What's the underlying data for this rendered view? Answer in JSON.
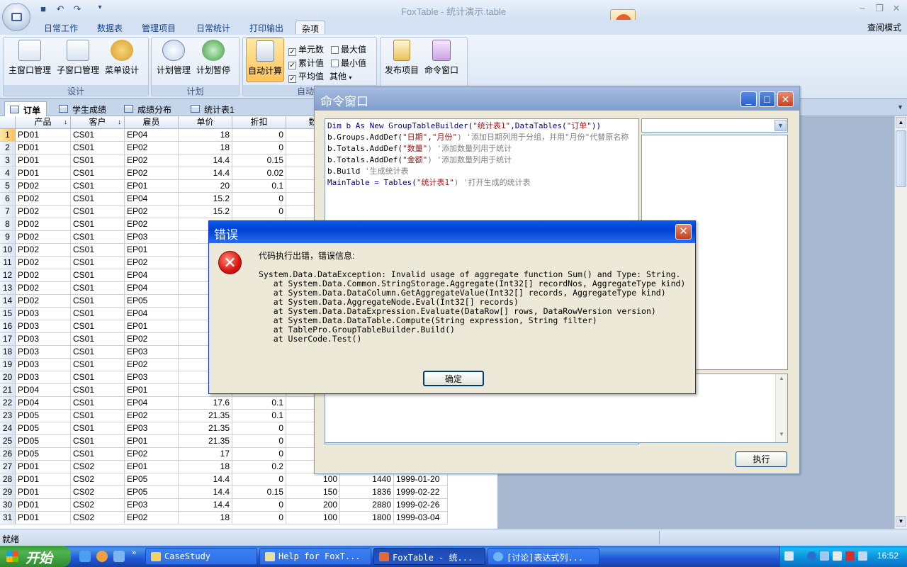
{
  "app": {
    "title": "FoxTable - 统计演示.table",
    "view_mode": "查阅模式"
  },
  "ribbon": {
    "tabs": [
      "日常工作",
      "数据表",
      "管理项目",
      "日常统计",
      "打印输出",
      "杂项"
    ],
    "groups": {
      "design": {
        "label": "设计",
        "buttons": [
          "主窗口管理",
          "子窗口管理",
          "菜单设计"
        ]
      },
      "plan": {
        "label": "计划",
        "buttons": [
          "计划管理",
          "计划暂停"
        ]
      },
      "auto": {
        "label": "自动计",
        "button": "自动计算",
        "checks": [
          {
            "label": "单元数",
            "checked": true
          },
          {
            "label": "最大值",
            "checked": false
          },
          {
            "label": "累计值",
            "checked": true
          },
          {
            "label": "最小值",
            "checked": false
          },
          {
            "label": "平均值",
            "checked": true
          }
        ],
        "other": "其他"
      },
      "publish": {
        "buttons": [
          "发布项目",
          "命令窗口"
        ]
      }
    }
  },
  "sheet_tabs": [
    "订单",
    "学生成绩",
    "成绩分布",
    "统计表1"
  ],
  "grid": {
    "columns": [
      "产品",
      "客户",
      "雇员",
      "单价",
      "折扣",
      "数"
    ],
    "rows": [
      [
        "1",
        "PD01",
        "CS01",
        "EP04",
        "18",
        "0",
        "",
        "",
        ""
      ],
      [
        "2",
        "PD01",
        "CS01",
        "EP02",
        "18",
        "0",
        "",
        "",
        ""
      ],
      [
        "3",
        "PD01",
        "CS01",
        "EP02",
        "14.4",
        "0.15",
        "",
        "",
        ""
      ],
      [
        "4",
        "PD01",
        "CS01",
        "EP02",
        "14.4",
        "0.02",
        "",
        "",
        ""
      ],
      [
        "5",
        "PD02",
        "CS01",
        "EP01",
        "20",
        "0.1",
        "",
        "",
        ""
      ],
      [
        "6",
        "PD02",
        "CS01",
        "EP04",
        "15.2",
        "0",
        "",
        "",
        ""
      ],
      [
        "7",
        "PD02",
        "CS01",
        "EP02",
        "15.2",
        "0",
        "",
        "",
        ""
      ],
      [
        "8",
        "PD02",
        "CS01",
        "EP02",
        "",
        "",
        "",
        "",
        ""
      ],
      [
        "9",
        "PD02",
        "CS01",
        "EP03",
        "",
        "",
        "",
        "",
        ""
      ],
      [
        "10",
        "PD02",
        "CS01",
        "EP01",
        "",
        "",
        "",
        "",
        ""
      ],
      [
        "11",
        "PD02",
        "CS01",
        "EP02",
        "",
        "",
        "",
        "",
        ""
      ],
      [
        "12",
        "PD02",
        "CS01",
        "EP04",
        "",
        "",
        "",
        "",
        ""
      ],
      [
        "13",
        "PD02",
        "CS01",
        "EP04",
        "",
        "",
        "",
        "",
        ""
      ],
      [
        "14",
        "PD02",
        "CS01",
        "EP05",
        "",
        "",
        "",
        "",
        ""
      ],
      [
        "15",
        "PD03",
        "CS01",
        "EP04",
        "",
        "",
        "",
        "",
        ""
      ],
      [
        "16",
        "PD03",
        "CS01",
        "EP01",
        "",
        "",
        "",
        "",
        ""
      ],
      [
        "17",
        "PD03",
        "CS01",
        "EP02",
        "",
        "",
        "",
        "",
        ""
      ],
      [
        "18",
        "PD03",
        "CS01",
        "EP03",
        "",
        "",
        "",
        "",
        ""
      ],
      [
        "19",
        "PD03",
        "CS01",
        "EP02",
        "",
        "",
        "",
        "",
        ""
      ],
      [
        "20",
        "PD03",
        "CS01",
        "EP03",
        "",
        "",
        "",
        "",
        ""
      ],
      [
        "21",
        "PD04",
        "CS01",
        "EP01",
        "",
        "",
        "",
        "",
        ""
      ],
      [
        "22",
        "PD04",
        "CS01",
        "EP04",
        "17.6",
        "0.1",
        "",
        "",
        ""
      ],
      [
        "23",
        "PD05",
        "CS01",
        "EP02",
        "21.35",
        "0.1",
        "",
        "",
        ""
      ],
      [
        "24",
        "PD05",
        "CS01",
        "EP03",
        "21.35",
        "0",
        "",
        "",
        ""
      ],
      [
        "25",
        "PD05",
        "CS01",
        "EP01",
        "21.35",
        "0",
        "",
        "",
        ""
      ],
      [
        "26",
        "PD05",
        "CS01",
        "EP02",
        "17",
        "0",
        "",
        "",
        ""
      ],
      [
        "27",
        "PD01",
        "CS02",
        "EP01",
        "18",
        "0.2",
        "",
        "",
        ""
      ],
      [
        "28",
        "PD01",
        "CS02",
        "EP05",
        "14.4",
        "0",
        "100",
        "1440",
        "1999-01-20"
      ],
      [
        "29",
        "PD01",
        "CS02",
        "EP05",
        "14.4",
        "0.15",
        "150",
        "1836",
        "1999-02-22"
      ],
      [
        "30",
        "PD01",
        "CS02",
        "EP03",
        "14.4",
        "0",
        "200",
        "2880",
        "1999-02-26"
      ],
      [
        "31",
        "PD01",
        "CS02",
        "EP02",
        "18",
        "0",
        "100",
        "1800",
        "1999-03-04"
      ]
    ]
  },
  "status": {
    "text": "就绪"
  },
  "cmd_window": {
    "title": "命令窗口",
    "code": [
      [
        {
          "t": "Dim b As New GroupTableBuilder(",
          "c": "kw"
        },
        {
          "t": "\"统计表1\"",
          "c": "str"
        },
        {
          "t": ",DataTables(",
          "c": "kw"
        },
        {
          "t": "\"订单\"",
          "c": "str"
        },
        {
          "t": "))",
          "c": "kw"
        }
      ],
      [
        {
          "t": "b.Groups.AddDef(",
          "c": ""
        },
        {
          "t": "\"日期\"",
          "c": "str"
        },
        {
          "t": ",",
          "c": ""
        },
        {
          "t": "\"月份\"",
          "c": "str"
        },
        {
          "t": ") '添加日期列用于分组，并用\"月份\"代替原名称",
          "c": "cm"
        }
      ],
      [
        {
          "t": "b.Totals.AddDef(",
          "c": ""
        },
        {
          "t": "\"数量\"",
          "c": "str"
        },
        {
          "t": ") '添加数量列用于统计",
          "c": "cm"
        }
      ],
      [
        {
          "t": "b.Totals.AddDef(",
          "c": ""
        },
        {
          "t": "\"金额\"",
          "c": "str"
        },
        {
          "t": ") '添加数量列用于统计",
          "c": "cm"
        }
      ],
      [
        {
          "t": "b.Build ",
          "c": ""
        },
        {
          "t": "'生成统计表",
          "c": "cm"
        }
      ],
      [
        {
          "t": "MainTable = Tables(",
          "c": "kw"
        },
        {
          "t": "\"统计表1\"",
          "c": "str"
        },
        {
          "t": ") '打开生成的统计表",
          "c": "cm"
        }
      ]
    ],
    "run_button": "执行"
  },
  "error_dialog": {
    "title": "错误",
    "heading": "代码执行出错，错误信息:",
    "lines": [
      "System.Data.DataException: Invalid usage of aggregate function Sum() and Type: String.",
      "   at System.Data.Common.StringStorage.Aggregate(Int32[] recordNos, AggregateType kind)",
      "   at System.Data.DataColumn.GetAggregateValue(Int32[] records, AggregateType kind)",
      "   at System.Data.AggregateNode.Eval(Int32[] records)",
      "   at System.Data.DataExpression.Evaluate(DataRow[] rows, DataRowVersion version)",
      "   at System.Data.DataTable.Compute(String expression, String filter)",
      "   at TablePro.GroupTableBuilder.Build()",
      "   at UserCode.Test()"
    ],
    "ok_button": "确定"
  },
  "taskbar": {
    "start": "开始",
    "tasks": [
      "CaseStudy",
      "Help for FoxT...",
      "FoxTable - 统...",
      "[讨论]表达式列..."
    ],
    "clock": "16:52"
  }
}
